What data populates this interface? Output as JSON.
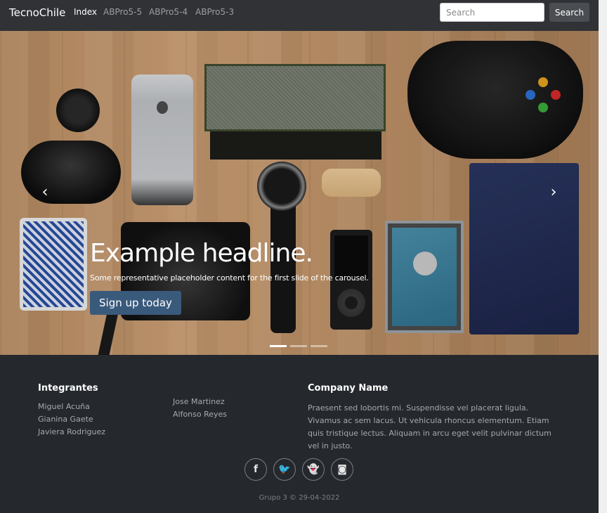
{
  "navbar": {
    "brand": "TecnoChile",
    "links": [
      "Index",
      "ABPro5-5",
      "ABPro5-4",
      "ABPro5-3"
    ],
    "active_link": "Index",
    "search_placeholder": "Search",
    "search_button": "Search"
  },
  "carousel": {
    "headline": "Example headline.",
    "lead": "Some representative placeholder content for the first slide of the carousel.",
    "cta": "Sign up today",
    "prev_icon": "chevron-left-icon",
    "next_icon": "chevron-right-icon",
    "prev_glyph": "‹",
    "next_glyph": "›",
    "slide_count": 3,
    "active_slide": 1
  },
  "footer": {
    "members_heading": "Integrantes",
    "members_col1": [
      "Miguel Acuña",
      "Gianina Gaete",
      "Javiera Rodriguez"
    ],
    "members_col2": [
      "Jose Martinez",
      "Alfonso Reyes"
    ],
    "company_heading": "Company Name",
    "company_text": "Praesent sed lobortis mi. Suspendisse vel placerat ligula. Vivamus ac sem lacus. Ut vehicula rhoncus elementum. Etiam quis tristique lectus. Aliquam in arcu eget velit pulvinar dictum vel in justo.",
    "social": [
      {
        "icon": "facebook-icon",
        "glyph": "f"
      },
      {
        "icon": "twitter-icon",
        "glyph": "🐦"
      },
      {
        "icon": "snapchat-icon",
        "glyph": "👻"
      },
      {
        "icon": "instagram-icon",
        "glyph": "◙"
      }
    ],
    "copyright": "Grupo 3 © 29-04-2022"
  },
  "colors": {
    "navbar_bg": "#303236",
    "footer_bg": "#25292d",
    "cta_bg": "#3a5a7c"
  }
}
